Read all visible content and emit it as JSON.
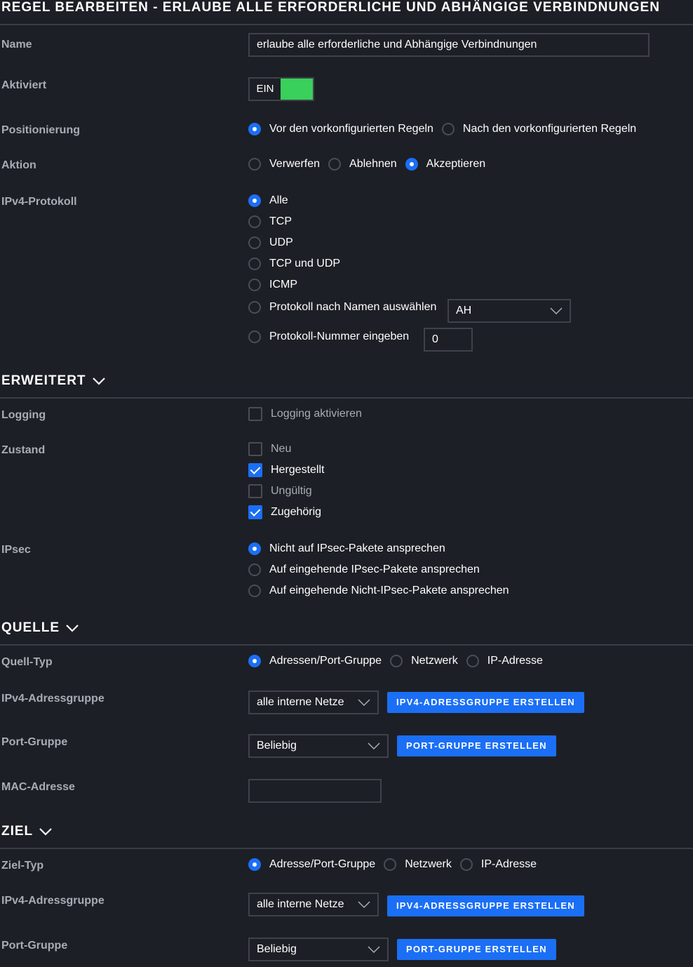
{
  "title": "REGEL BEARBEITEN - ERLAUBE ALLE ERFORDERLICHE UND ABHÄNGIGE VERBINDNUNGEN",
  "colors": {
    "background": "#1d1f26",
    "accent": "#1b6ff5",
    "toggle_on": "#39d05c",
    "label": "#a9acb4"
  },
  "general": {
    "name_label": "Name",
    "name_value": "erlaube alle erforderliche und  Abhängige Verbindnungen",
    "enabled_label": "Aktiviert",
    "toggle_label": "EIN",
    "position_label": "Positionierung",
    "position_options": [
      "Vor den vorkonfigurierten Regeln",
      "Nach den vorkonfigurierten Regeln"
    ],
    "position_selected": 0,
    "action_label": "Aktion",
    "action_options": [
      "Verwerfen",
      "Ablehnen",
      "Akzeptieren"
    ],
    "action_selected": 2,
    "protocol_label": "IPv4-Protokoll",
    "protocol_options": [
      "Alle",
      "TCP",
      "UDP",
      "TCP und UDP",
      "ICMP",
      "Protokoll nach Namen auswählen",
      "Protokoll-Nummer eingeben"
    ],
    "protocol_selected": 0,
    "protocol_name_value": "AH",
    "protocol_number_value": "0"
  },
  "advanced": {
    "section_title": "ERWEITERT",
    "logging_label": "Logging",
    "logging_option": "Logging aktivieren",
    "state_label": "Zustand",
    "state_options": [
      "Neu",
      "Hergestellt",
      "Ungültig",
      "Zugehörig"
    ],
    "state_checked": [
      false,
      true,
      false,
      true
    ],
    "ipsec_label": "IPsec",
    "ipsec_options": [
      "Nicht auf IPsec-Pakete ansprechen",
      "Auf eingehende IPsec-Pakete ansprechen",
      "Auf eingehende Nicht-IPsec-Pakete ansprechen"
    ],
    "ipsec_selected": 0
  },
  "source": {
    "section_title": "QUELLE",
    "type_label": "Quell-Typ",
    "type_options": [
      "Adressen/Port-Gruppe",
      "Netzwerk",
      "IP-Adresse"
    ],
    "type_selected": 0,
    "addr_group_label": "IPv4-Adressgruppe",
    "addr_group_value": "alle interne Netze",
    "addr_group_button": "IPV4-ADRESSGRUPPE ERSTELLEN",
    "port_group_label": "Port-Gruppe",
    "port_group_value": "Beliebig",
    "port_group_button": "PORT-GRUPPE ERSTELLEN",
    "mac_label": "MAC-Adresse",
    "mac_value": ""
  },
  "destination": {
    "section_title": "ZIEL",
    "type_label": "Ziel-Typ",
    "type_options": [
      "Adresse/Port-Gruppe",
      "Netzwerk",
      "IP-Adresse"
    ],
    "type_selected": 0,
    "addr_group_label": "IPv4-Adressgruppe",
    "addr_group_value": "alle interne Netze",
    "addr_group_button": "IPV4-ADRESSGRUPPE ERSTELLEN",
    "port_group_label": "Port-Gruppe",
    "port_group_value": "Beliebig",
    "port_group_button": "PORT-GRUPPE ERSTELLEN"
  }
}
